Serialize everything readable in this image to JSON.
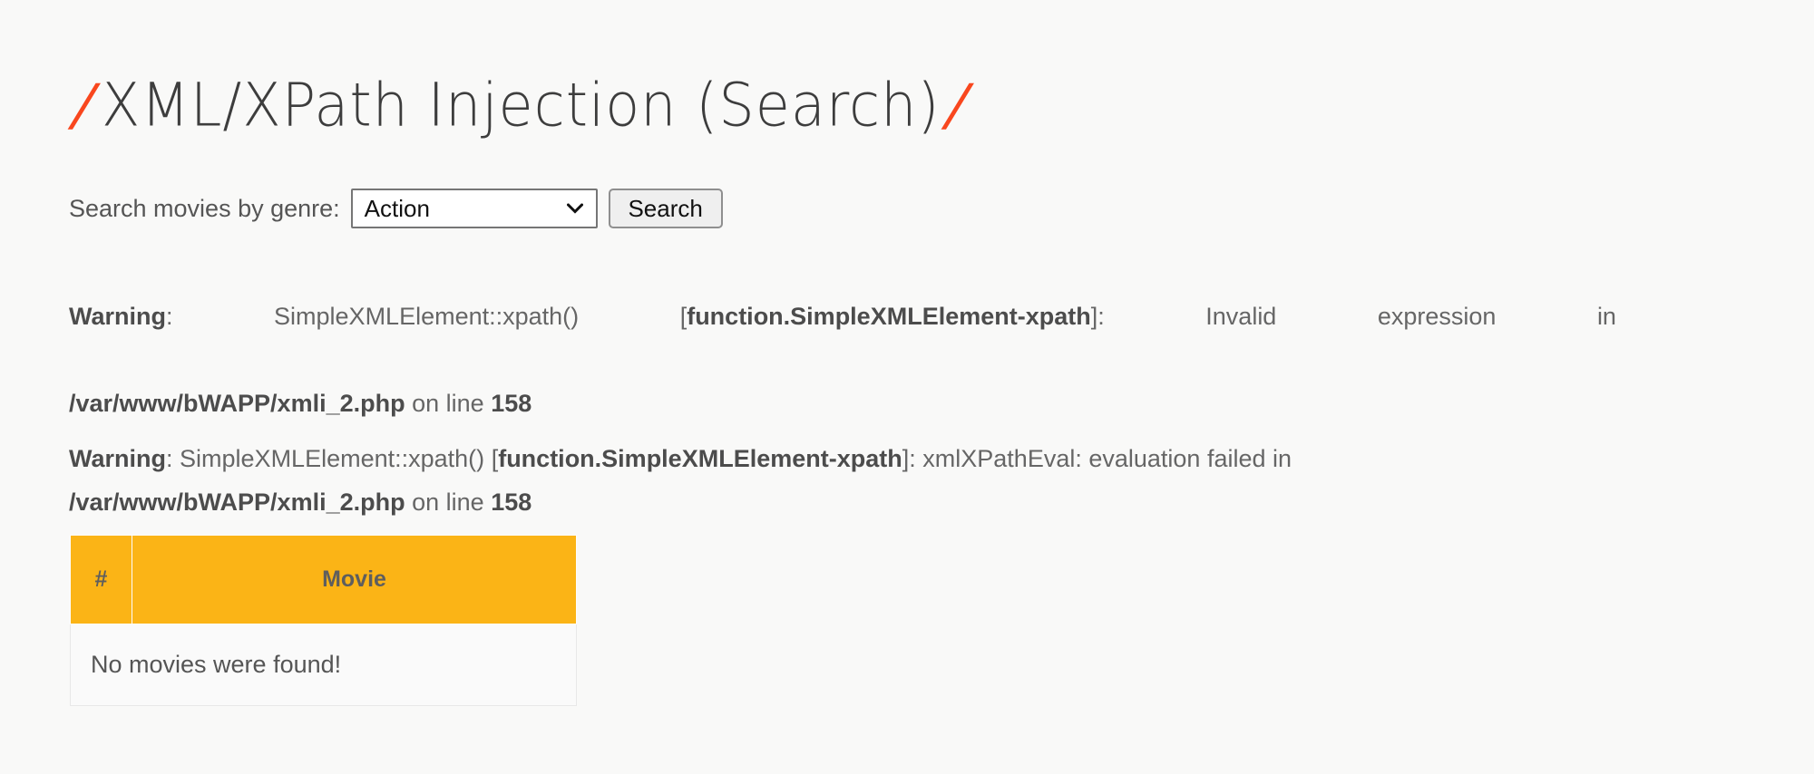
{
  "page": {
    "title_prefix_slash": "/",
    "title_text": "XML/XPath Injection (Search)",
    "title_suffix_slash": "/",
    "accent_slash_color": "#f9471e",
    "background_color": "#f9f9f8"
  },
  "search_form": {
    "label": "Search movies by genre:",
    "select": {
      "name": "genre-select",
      "selected_value": "Action",
      "icon": "chevron-down-icon"
    },
    "button_label": "Search"
  },
  "warnings": [
    {
      "id": "warning-1",
      "label": "Warning",
      "separator": ":",
      "function_call": "SimpleXMLElement::xpath()",
      "bracket_open": "[",
      "function_ref": "function.SimpleXMLElement-xpath",
      "bracket_close": "]",
      "separator_2": ":",
      "message": "Invalid expression",
      "in_word": "in",
      "file_path": "/var/www/bWAPP/xmli_2.php",
      "on_line_text": "on line",
      "line_number": "158"
    },
    {
      "id": "warning-2",
      "label": "Warning",
      "separator": ":",
      "function_call": "SimpleXMLElement::xpath()",
      "bracket_open": "[",
      "function_ref": "function.SimpleXMLElement-xpath",
      "bracket_close": "]",
      "separator_2": ":",
      "message": "xmlXPathEval: evaluation failed",
      "in_word": "in",
      "file_path": "/var/www/bWAPP/xmli_2.php",
      "on_line_text": "on line",
      "line_number": "158"
    }
  ],
  "results_table": {
    "header_color": "#fbb416",
    "columns": [
      "#",
      "Movie"
    ],
    "empty_message": "No movies were found!"
  }
}
